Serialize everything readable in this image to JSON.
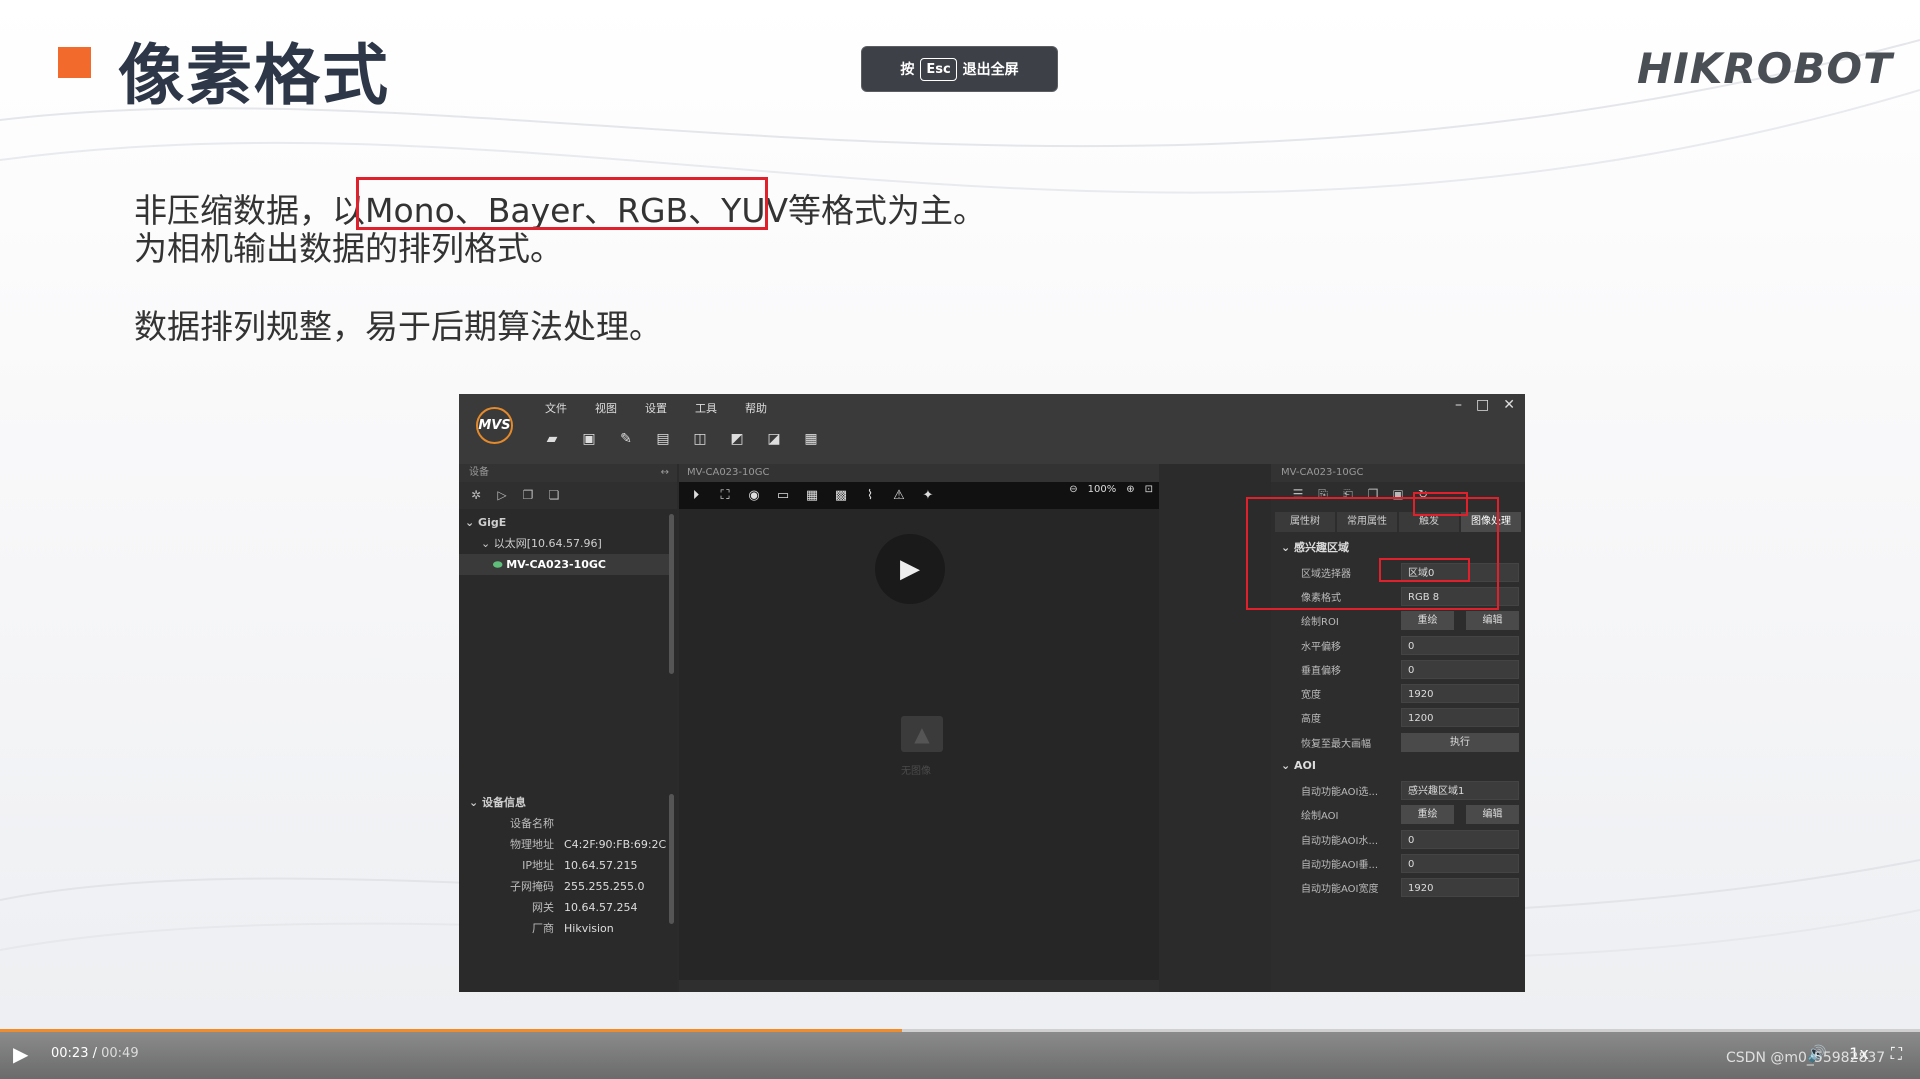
{
  "slide": {
    "title": "像素格式",
    "esc_hint": {
      "prefix": "按",
      "key": "Esc",
      "suffix": "退出全屏"
    },
    "logo": "HIKROBOT",
    "lines": [
      "非压缩数据，以Mono、Bayer、RGB、YUV等格式为主。",
      "为相机输出数据的排列格式。",
      "数据排列规整，易于后期算法处理。"
    ],
    "accent_color": "#f26a2c",
    "highlight_color": "#e0202a"
  },
  "app": {
    "menu": [
      "文件",
      "视图",
      "设置",
      "工具",
      "帮助"
    ],
    "logo_text": "MVS",
    "window_controls": [
      "minimize-icon",
      "maximize-icon",
      "close-icon"
    ],
    "devices": {
      "header": "设备",
      "tree": {
        "group": "GigE",
        "network": "以太网[10.64.57.96]",
        "device": "MV-CA023-10GC"
      }
    },
    "device_info": {
      "header": "设备信息",
      "rows": [
        {
          "k": "设备名称",
          "v": ""
        },
        {
          "k": "物理地址",
          "v": "C4:2F:90:FB:69:2C"
        },
        {
          "k": "IP地址",
          "v": "10.64.57.215"
        },
        {
          "k": "子网掩码",
          "v": "255.255.255.0"
        },
        {
          "k": "网关",
          "v": "10.64.57.254"
        },
        {
          "k": "厂商",
          "v": "Hikvision"
        }
      ]
    },
    "viewer": {
      "title": "MV-CA023-10GC",
      "zoom": "100%",
      "no_image": "无图像"
    },
    "props": {
      "title": "MV-CA023-10GC",
      "tabs": [
        "属性树",
        "常用属性",
        "触发",
        "图像处理"
      ],
      "active_tab": 3,
      "section1": "感兴趣区域",
      "section2": "AOI",
      "rows1": [
        {
          "k": "区域选择器",
          "v": "区域0",
          "type": "select"
        },
        {
          "k": "像素格式",
          "v": "RGB 8",
          "type": "select"
        },
        {
          "k": "绘制ROI",
          "b1": "重绘",
          "b2": "编辑",
          "type": "buttons"
        },
        {
          "k": "水平偏移",
          "v": "0",
          "type": "spin"
        },
        {
          "k": "垂直偏移",
          "v": "0",
          "type": "spin"
        },
        {
          "k": "宽度",
          "v": "1920",
          "type": "spin"
        },
        {
          "k": "高度",
          "v": "1200",
          "type": "spin"
        },
        {
          "k": "恢复至最大画幅",
          "b": "执行",
          "type": "button"
        }
      ],
      "rows2": [
        {
          "k": "自动功能AOI选...",
          "v": "感兴趣区域1",
          "type": "select"
        },
        {
          "k": "绘制AOI",
          "b1": "重绘",
          "b2": "编辑",
          "type": "buttons"
        },
        {
          "k": "自动功能AOI水...",
          "v": "0",
          "type": "spin"
        },
        {
          "k": "自动功能AOI垂...",
          "v": "0",
          "type": "spin"
        },
        {
          "k": "自动功能AOI宽度",
          "v": "1920",
          "type": "spin"
        }
      ]
    }
  },
  "player": {
    "current": "00:23",
    "total": "00:49",
    "progress": 0.47,
    "speed": "1x",
    "watermark": "CSDN @m0_55982837"
  }
}
